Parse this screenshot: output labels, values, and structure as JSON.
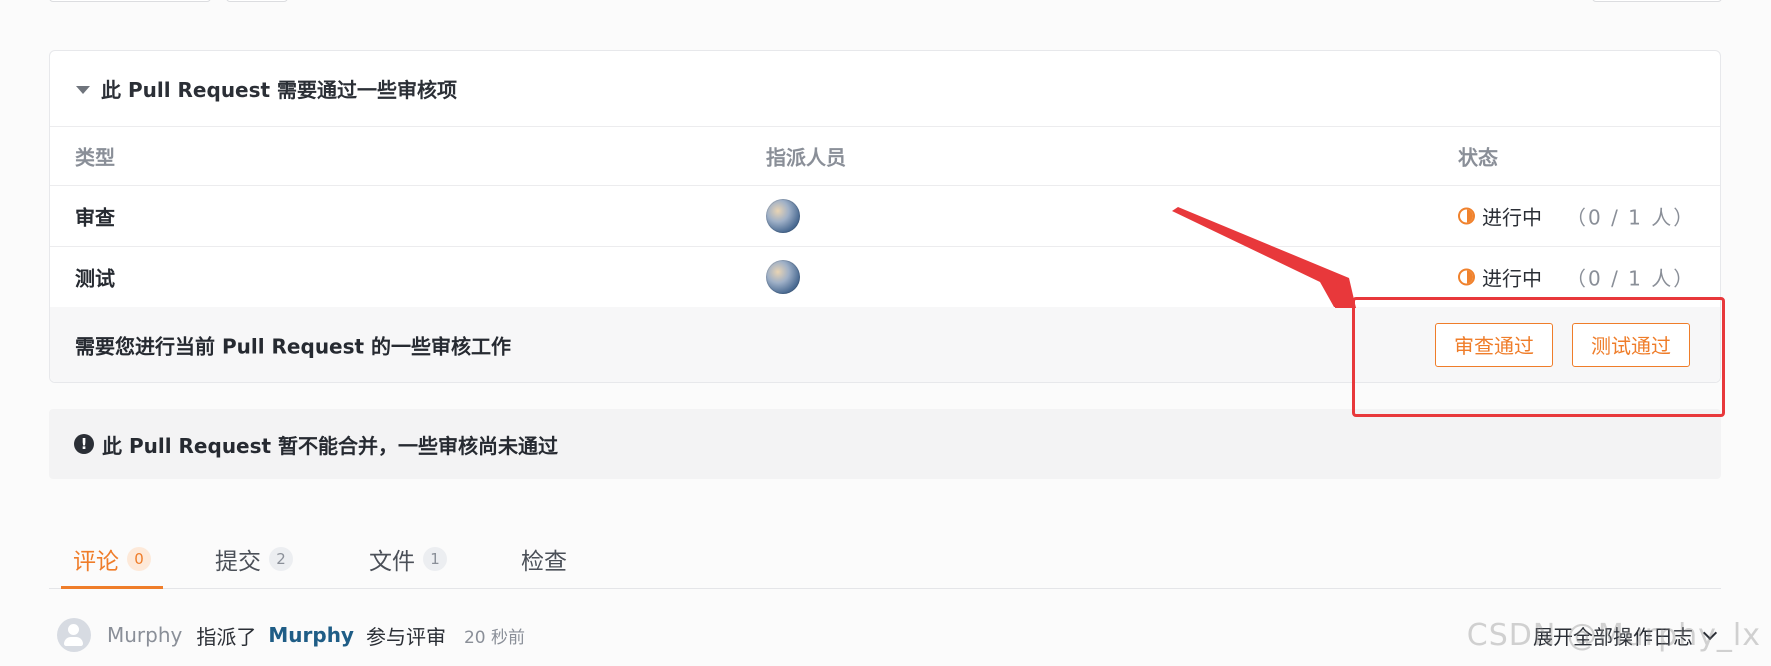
{
  "review": {
    "header": "此 Pull Request 需要通过一些审核项",
    "columns": {
      "type": "类型",
      "assignee": "指派人员",
      "status": "状态"
    },
    "rows": [
      {
        "type": "审查",
        "status": "进行中",
        "count": "（0 / 1 人）"
      },
      {
        "type": "测试",
        "status": "进行中",
        "count": "（0 / 1 人）"
      }
    ],
    "action_text": "需要您进行当前 Pull Request 的一些审核工作",
    "buttons": {
      "review_pass": "审查通过",
      "test_pass": "测试通过"
    }
  },
  "merge_notice": "此 Pull Request 暂不能合并，一些审核尚未通过",
  "tabs": [
    {
      "label": "评论",
      "count": "0"
    },
    {
      "label": "提交",
      "count": "2"
    },
    {
      "label": "文件",
      "count": "1"
    },
    {
      "label": "检查",
      "count": ""
    }
  ],
  "activity": {
    "actor": "Murphy",
    "verb": "指派了",
    "target": "Murphy",
    "suffix": "参与评审",
    "time": "20 秒前",
    "expand_label": "展开全部操作日志"
  },
  "watermark": "CSDN @Murphy_lx",
  "colors": {
    "accent": "#ef7d2a",
    "annotation": "#e8383b"
  },
  "icons": {
    "caret": "caret-down-icon",
    "status": "in-progress-icon",
    "notice": "exclamation-circle-icon",
    "expand": "chevron-down-icon"
  }
}
